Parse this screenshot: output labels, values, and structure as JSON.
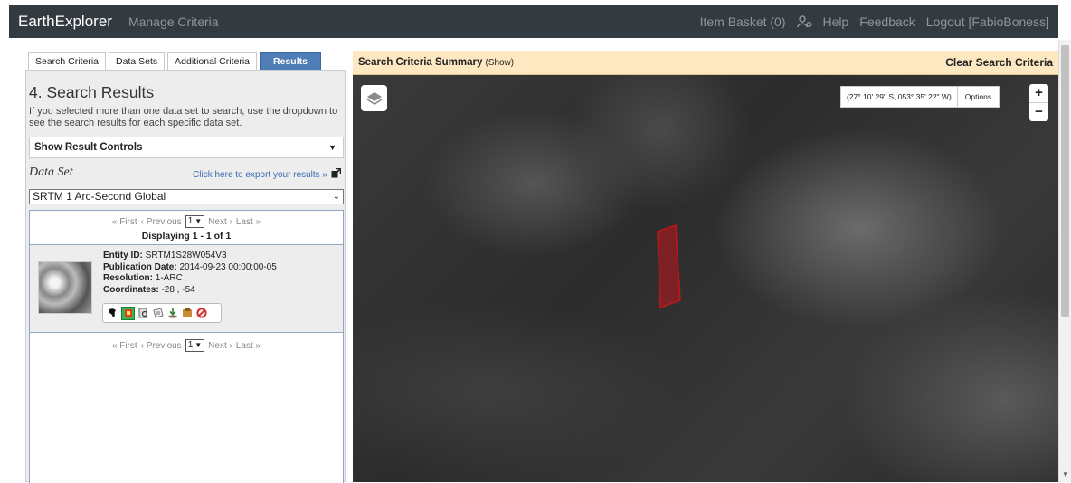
{
  "topbar": {
    "brand": "EarthExplorer",
    "manage": "Manage Criteria",
    "basket": "Item Basket (0)",
    "help": "Help",
    "feedback": "Feedback",
    "logout": "Logout [FabioBoness]"
  },
  "tabs": [
    "Search Criteria",
    "Data Sets",
    "Additional Criteria",
    "Results"
  ],
  "results_panel": {
    "title": "4. Search Results",
    "description": "If you selected more than one data set to search, use the dropdown to see the search results for each specific data set.",
    "controls_label": "Show Result Controls",
    "dataset_label": "Data Set",
    "export_link": "Click here to export your results »",
    "dataset_selected": "SRTM 1 Arc-Second Global",
    "pager": {
      "first": "« First",
      "previous": "‹ Previous",
      "page": "1",
      "next": "Next ›",
      "last": "Last »"
    },
    "displaying": "Displaying 1 - 1 of 1",
    "item": {
      "entity_label": "Entity ID:",
      "entity_value": "SRTM1S28W054V3",
      "pub_label": "Publication Date:",
      "pub_value": "2014-09-23 00:00:00-05",
      "res_label": "Resolution:",
      "res_value": "1-ARC",
      "coord_label": "Coordinates:",
      "coord_value": "-28 , -54"
    }
  },
  "map_panel": {
    "summary_title": "Search Criteria Summary",
    "summary_show": "(Show)",
    "clear": "Clear Search Criteria",
    "coords": "(27° 10' 29\" S, 053° 35' 22\" W)",
    "options": "Options",
    "zoom_in": "+",
    "zoom_out": "−"
  },
  "colors": {
    "topbar_bg": "#333a40",
    "active_tab": "#4f7db6",
    "summary_bg": "#fde8c2",
    "footprint": "#c0161b"
  }
}
